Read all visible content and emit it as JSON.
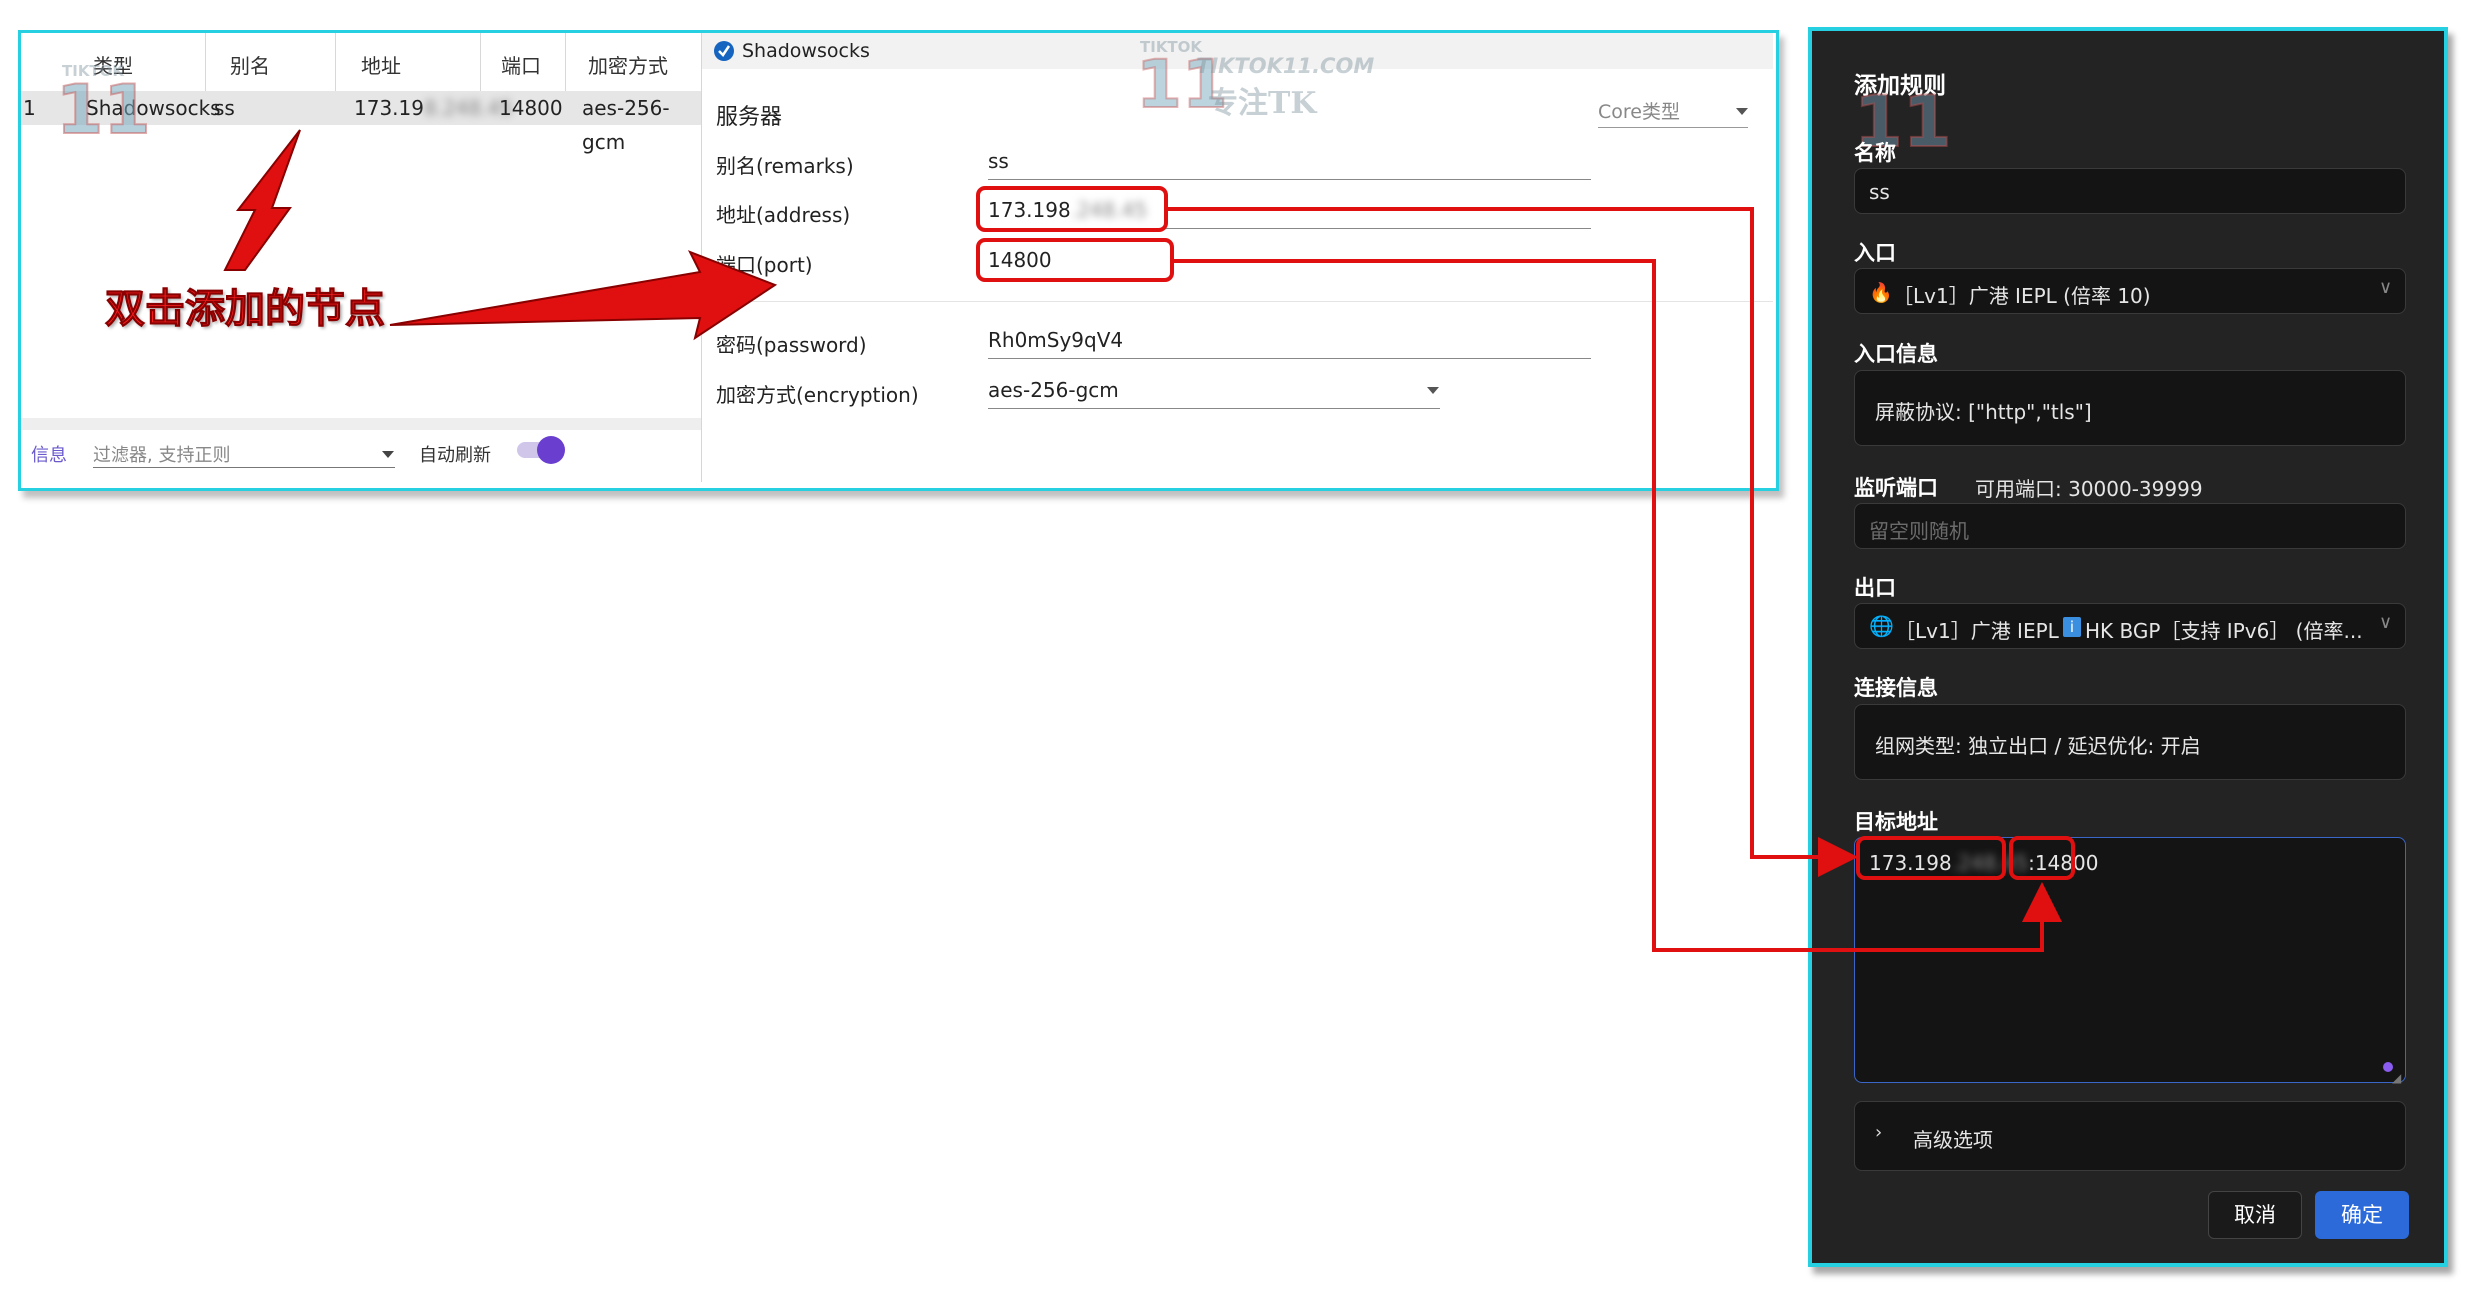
{
  "list": {
    "headers": [
      "类型",
      "别名",
      "地址",
      "端口",
      "加密方式"
    ],
    "row": {
      "index": "1",
      "type": "Shadowsocks",
      "alias": "ss",
      "address": "173.19",
      "address_blurred": "8.248.45",
      "port": "14800",
      "encryption": "aes-256-gcm"
    },
    "bottom": {
      "info_tab": "信息",
      "filter_placeholder": "过滤器, 支持正则",
      "auto_refresh": "自动刷新"
    }
  },
  "form": {
    "window_title": "Shadowsocks",
    "section": "服务器",
    "core_type": "Core类型",
    "fields": {
      "remarks_label": "别名(remarks)",
      "remarks_value": "ss",
      "address_label": "地址(address)",
      "address_value": "173.198",
      "address_blurred": ".248.45",
      "port_label": "端口(port)",
      "port_value": "14800",
      "password_label": "密码(password)",
      "password_value": "Rh0mSy9qV4",
      "encryption_label": "加密方式(encryption)",
      "encryption_value": "aes-256-gcm"
    }
  },
  "annotation": {
    "text": "双击添加的节点",
    "color": "#e01010"
  },
  "watermark": {
    "top": "TIKTOK",
    "number": "11",
    "site": "TIKTOK11.COM",
    "slogan": "专注TK"
  },
  "dialog": {
    "title": "添加规则",
    "name_label": "名称",
    "name_value": "ss",
    "entry_label": "入口",
    "entry_value": "［Lv1］广港 IEPL (倍率 10)",
    "entry_info_label": "入口信息",
    "entry_info_value": "屏蔽协议: [\"http\",\"tls\"]",
    "listen_port_label": "监听端口",
    "listen_port_hint": "可用端口: 30000-39999",
    "listen_port_placeholder": "留空则随机",
    "exit_label": "出口",
    "exit_value_a": "［Lv1］广港 IEPL",
    "exit_badge": "i",
    "exit_value_b": "HK BGP［支持 IPv6］ (倍率...",
    "conn_info_label": "连接信息",
    "conn_info_value": "组网类型: 独立出口 / 延迟优化: 开启",
    "target_label": "目标地址",
    "target_ip": "173.198",
    "target_ip_blurred": ".248.45",
    "target_sep": ":",
    "target_port": "14800",
    "advanced": "高级选项",
    "cancel": "取消",
    "ok": "确定",
    "accent": "#2d6ad9"
  },
  "colors": {
    "frame": "#27d0e0",
    "highlight": "#e01010"
  }
}
